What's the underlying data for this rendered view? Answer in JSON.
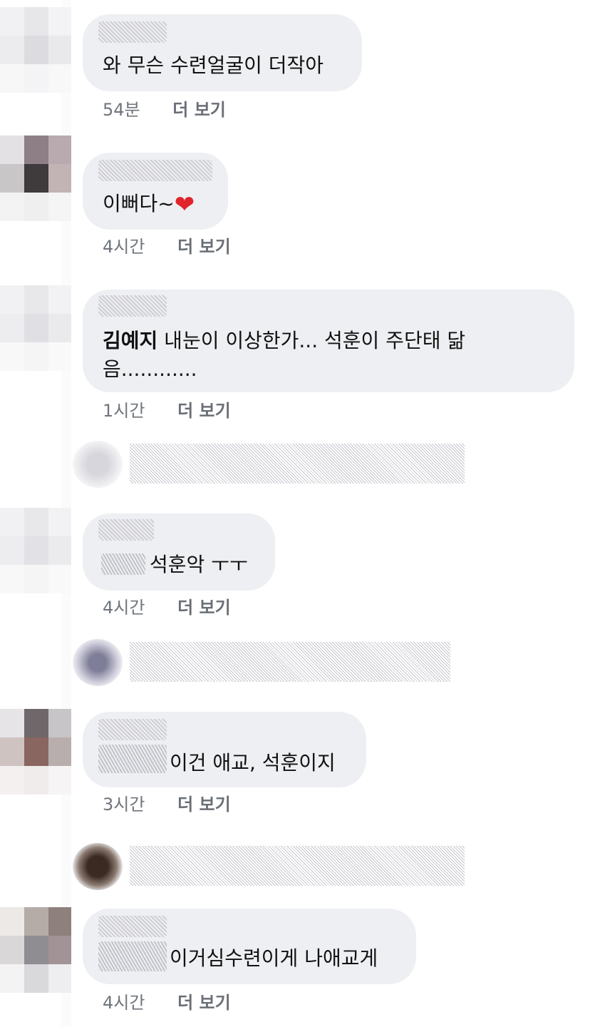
{
  "comments": [
    {
      "text": "와 무슨 수련얼굴이 더작아",
      "time": "54분",
      "more": "더 보기"
    },
    {
      "text": "이뻐다~",
      "emoji": "❤",
      "time": "4시간",
      "more": "더 보기"
    },
    {
      "mention": "김예지",
      "text_line1": " 내눈이 이상한가... 석훈이 주단태 닮",
      "text_line2": "음............",
      "time": "1시간",
      "more": "더 보기"
    },
    {
      "text": "석훈악 ㅜㅜ",
      "time": "4시간",
      "more": "더 보기"
    },
    {
      "text": "이건 애교, 석훈이지",
      "time": "3시간",
      "more": "더 보기"
    },
    {
      "text": "이거심수련이게 나애교게",
      "time": "4시간",
      "more": "더 보기"
    }
  ],
  "colors": {
    "bubble": "#eeeff2",
    "meta": "#70757c",
    "text": "#111111",
    "heart": "#e0242b"
  },
  "icons": {
    "reaction": "heart-emoji"
  }
}
